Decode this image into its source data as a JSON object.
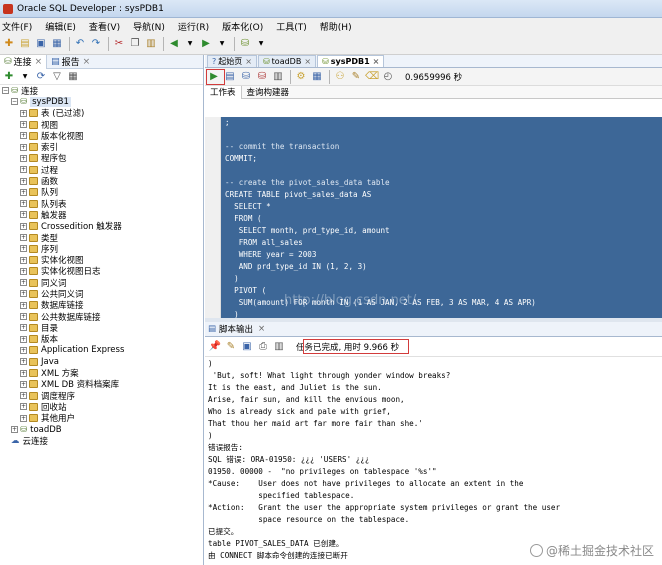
{
  "window": {
    "title": "Oracle SQL Developer : sysPDB1"
  },
  "menu": [
    "文件(F)",
    "编辑(E)",
    "查看(V)",
    "导航(N)",
    "运行(R)",
    "版本化(O)",
    "工具(T)",
    "帮助(H)"
  ],
  "left_panel": {
    "tabs": [
      "连接",
      "报告"
    ],
    "tree": [
      {
        "label": "连接",
        "level": 0,
        "kind": "root"
      },
      {
        "label": "sysPDB1",
        "level": 1,
        "kind": "connection"
      },
      {
        "label": "表 (已过滤)",
        "level": 2,
        "kind": "folder"
      },
      {
        "label": "视图",
        "level": 2,
        "kind": "folder"
      },
      {
        "label": "版本化视图",
        "level": 2,
        "kind": "folder"
      },
      {
        "label": "索引",
        "level": 2,
        "kind": "folder"
      },
      {
        "label": "程序包",
        "level": 2,
        "kind": "folder"
      },
      {
        "label": "过程",
        "level": 2,
        "kind": "folder"
      },
      {
        "label": "函数",
        "level": 2,
        "kind": "folder"
      },
      {
        "label": "队列",
        "level": 2,
        "kind": "folder"
      },
      {
        "label": "队列表",
        "level": 2,
        "kind": "folder"
      },
      {
        "label": "触发器",
        "level": 2,
        "kind": "folder"
      },
      {
        "label": "Crossedition 触发器",
        "level": 2,
        "kind": "folder"
      },
      {
        "label": "类型",
        "level": 2,
        "kind": "folder"
      },
      {
        "label": "序列",
        "level": 2,
        "kind": "folder"
      },
      {
        "label": "实体化视图",
        "level": 2,
        "kind": "folder"
      },
      {
        "label": "实体化视图日志",
        "level": 2,
        "kind": "folder"
      },
      {
        "label": "同义词",
        "level": 2,
        "kind": "folder"
      },
      {
        "label": "公共同义词",
        "level": 2,
        "kind": "folder"
      },
      {
        "label": "数据库链接",
        "level": 2,
        "kind": "folder"
      },
      {
        "label": "公共数据库链接",
        "level": 2,
        "kind": "folder"
      },
      {
        "label": "目录",
        "level": 2,
        "kind": "folder"
      },
      {
        "label": "版本",
        "level": 2,
        "kind": "folder"
      },
      {
        "label": "Application Express",
        "level": 2,
        "kind": "folder"
      },
      {
        "label": "Java",
        "level": 2,
        "kind": "folder"
      },
      {
        "label": "XML 方案",
        "level": 2,
        "kind": "folder"
      },
      {
        "label": "XML DB 资料档案库",
        "level": 2,
        "kind": "folder"
      },
      {
        "label": "调度程序",
        "level": 2,
        "kind": "folder"
      },
      {
        "label": "回收站",
        "level": 2,
        "kind": "folder"
      },
      {
        "label": "其他用户",
        "level": 2,
        "kind": "folder"
      },
      {
        "label": "toadDB",
        "level": 1,
        "kind": "connection"
      },
      {
        "label": "云连接",
        "level": 0,
        "kind": "root"
      }
    ]
  },
  "doc_tabs": [
    {
      "label": "起始页",
      "active": false
    },
    {
      "label": "toadDB",
      "active": false
    },
    {
      "label": "sysPDB1",
      "active": true
    }
  ],
  "worksheet": {
    "elapsed": "0.9659996 秒",
    "subtabs": [
      "工作表",
      "查询构建器"
    ]
  },
  "code_lines": [
    ";",
    "",
    "-- commit the transaction",
    "COMMIT;",
    "",
    "-- create the pivot_sales_data table",
    "CREATE TABLE pivot_sales_data AS",
    "  SELECT *",
    "  FROM (",
    "   SELECT month, prd_type_id, amount",
    "   FROM all_sales",
    "   WHERE year = 2003",
    "   AND prd_type_id IN (1, 2, 3)",
    "  )",
    "  PIVOT (",
    "   SUM(amount) FOR month IN (1 AS JAN, 2 AS FEB, 3 AS MAR, 4 AS APR)",
    "  )",
    "  ORDER BY prd_type_id;"
  ],
  "code_watermark": "http://blog.csdn.net/",
  "output": {
    "tab_label": "脚本输出",
    "status": "任务已完成, 用时 9.966 秒",
    "lines": [
      ")",
      " 'But, soft! What light through yonder window breaks?",
      "It is the east, and Juliet is the sun.",
      "Arise, fair sun, and kill the envious moon,",
      "Who is already sick and pale with grief,",
      "That thou her maid art far more fair than she.'",
      ")",
      "错误报告:",
      "SQL 错误: ORA-01950: ¿¿¿ 'USERS' ¿¿¿",
      "01950. 00000 -  \"no privileges on tablespace '%s'\"",
      "*Cause:    User does not have privileges to allocate an extent in the",
      "           specified tablespace.",
      "*Action:   Grant the user the appropriate system privileges or grant the user",
      "           space resource on the tablespace.",
      "已提交。",
      "table PIVOT_SALES_DATA 已创建。",
      "由 CONNECT 脚本命令创建的连接已断开"
    ]
  },
  "brand_watermark": "@稀土掘金技术社区"
}
